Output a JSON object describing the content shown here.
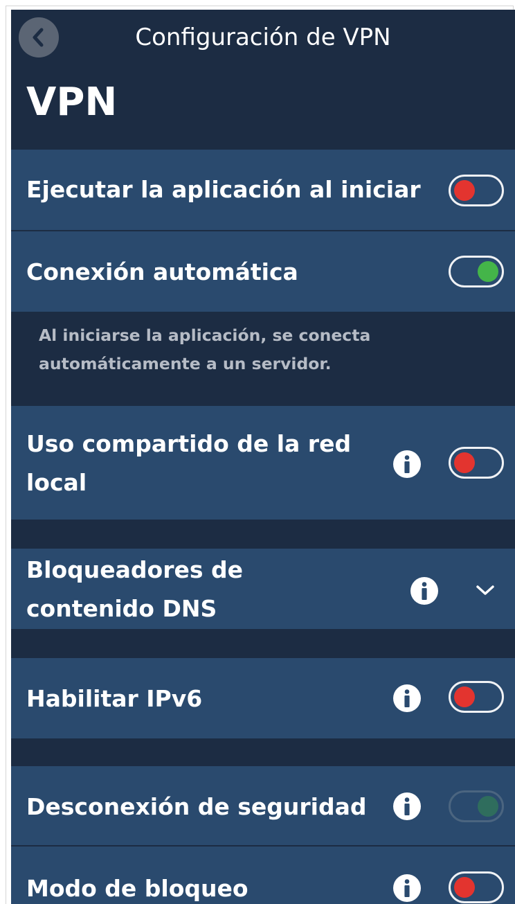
{
  "header": {
    "title": "Configuración de VPN"
  },
  "page": {
    "title": "VPN"
  },
  "settings": {
    "launch_on_start": {
      "label": "Ejecutar la aplicación al iniciar",
      "enabled": false
    },
    "auto_connect": {
      "label": "Conexión automática",
      "enabled": true,
      "description_line1": "Al iniciarse la aplicación, se conecta",
      "description_line2": "automáticamente a un servidor."
    },
    "local_network_sharing": {
      "label_line1": "Uso compartido de la red",
      "label_line2": "local",
      "enabled": false
    },
    "dns_blockers": {
      "label_line1": "Bloqueadores de",
      "label_line2": "contenido DNS",
      "expanded": false
    },
    "ipv6": {
      "label": "Habilitar IPv6",
      "enabled": false
    },
    "kill_switch": {
      "label": "Desconexión de seguridad",
      "enabled": true,
      "disabled": true
    },
    "lockdown_mode": {
      "label": "Modo de bloqueo",
      "enabled": false
    }
  },
  "colors": {
    "background": "#1c2c43",
    "row": "#2a4a6e",
    "toggle_off": "#e3342f",
    "toggle_on": "#44b549",
    "toggle_disabled_on": "#2f6d5d"
  },
  "icons": {
    "back": "chevron-left-icon",
    "info": "info-icon",
    "expand": "chevron-down-icon"
  }
}
